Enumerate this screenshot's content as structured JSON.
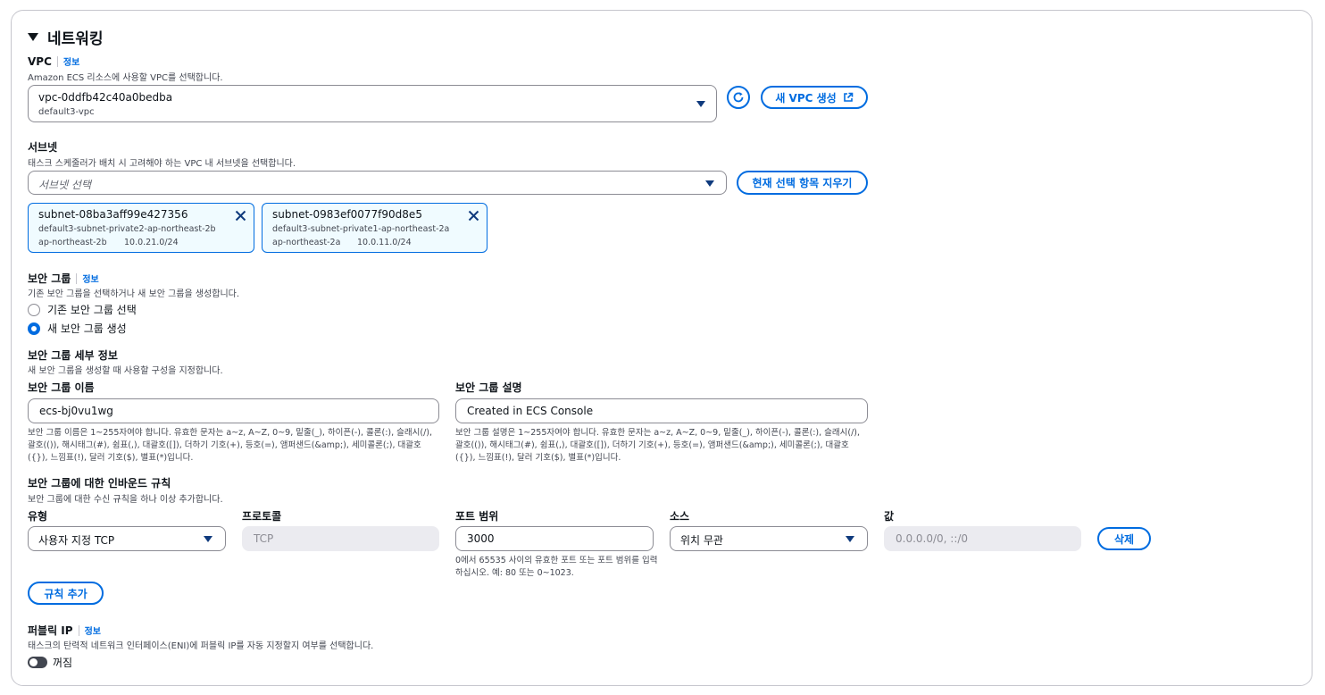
{
  "networking": {
    "title": "네트워킹",
    "info_label": "정보"
  },
  "vpc": {
    "label": "VPC",
    "description": "Amazon ECS 리소스에 사용할 VPC를 선택합니다.",
    "selected_id": "vpc-0ddfb42c40a0bedba",
    "selected_name": "default3-vpc",
    "create_button": "새 VPC 생성"
  },
  "subnets": {
    "label": "서브넷",
    "description": "태스크 스케줄러가 배치 시 고려해야 하는 VPC 내 서브넷을 선택합니다.",
    "placeholder": "서브넷 선택",
    "clear_button": "현재 선택 항목 지우기",
    "tokens": [
      {
        "id": "subnet-08ba3aff99e427356",
        "name": "default3-subnet-private2-ap-northeast-2b",
        "az": "ap-northeast-2b",
        "cidr": "10.0.21.0/24"
      },
      {
        "id": "subnet-0983ef0077f90d8e5",
        "name": "default3-subnet-private1-ap-northeast-2a",
        "az": "ap-northeast-2a",
        "cidr": "10.0.11.0/24"
      }
    ]
  },
  "security_group": {
    "label": "보안 그룹",
    "description": "기존 보안 그룹을 선택하거나 새 보안 그룹을 생성합니다.",
    "option_existing": "기존 보안 그룹 선택",
    "option_new": "새 보안 그룹 생성",
    "selected": "new"
  },
  "sg_details": {
    "label": "보안 그룹 세부 정보",
    "description": "새 보안 그룹을 생성할 때 사용할 구성을 지정합니다.",
    "name_label": "보안 그룹 이름",
    "name_value": "ecs-bj0vu1wg",
    "name_hint": "보안 그룹 이름은 1~255자여야 합니다. 유효한 문자는 a~z, A~Z, 0~9, 밑줄(_), 하이픈(-), 콜론(:), 슬래시(/), 괄호(()), 해시태그(#), 쉼표(,), 대괄호([]), 더하기 기호(+), 등호(=), 앰퍼샌드(&amp;), 세미콜론(;), 대괄호({}), 느낌표(!), 달러 기호($), 별표(*)입니다.",
    "desc_label": "보안 그룹 설명",
    "desc_value": "Created in ECS Console",
    "desc_hint": "보안 그룹 설명은 1~255자여야 합니다. 유효한 문자는 a~z, A~Z, 0~9, 밑줄(_), 하이픈(-), 콜론(:), 슬래시(/), 괄호(()), 해시태그(#), 쉼표(,), 대괄호([]), 더하기 기호(+), 등호(=), 앰퍼샌드(&amp;), 세미콜론(;), 대괄호({}), 느낌표(!), 달러 기호($), 별표(*)입니다."
  },
  "inbound": {
    "label": "보안 그룹에 대한 인바운드 규칙",
    "description": "보안 그룹에 대한 수신 규칙을 하나 이상 추가합니다.",
    "col_type": "유형",
    "col_protocol": "프로토콜",
    "col_port": "포트 범위",
    "col_source": "소스",
    "col_value": "값",
    "type_value": "사용자 지정 TCP",
    "protocol_value": "TCP",
    "port_value": "3000",
    "port_hint": "0에서 65535 사이의 유효한 포트 또는 포트 범위를 입력하십시오. 예: 80 또는 0~1023.",
    "source_value": "위치 무관",
    "value_placeholder": "0.0.0.0/0, ::/0",
    "delete_button": "삭제",
    "add_rule_button": "규칙 추가"
  },
  "public_ip": {
    "label": "퍼블릭 IP",
    "description": "태스크의 탄력적 네트워크 인터페이스(ENI)에 퍼블릭 IP를 자동 지정할지 여부를 선택합니다.",
    "toggle_label": "꺼짐",
    "enabled": false
  }
}
